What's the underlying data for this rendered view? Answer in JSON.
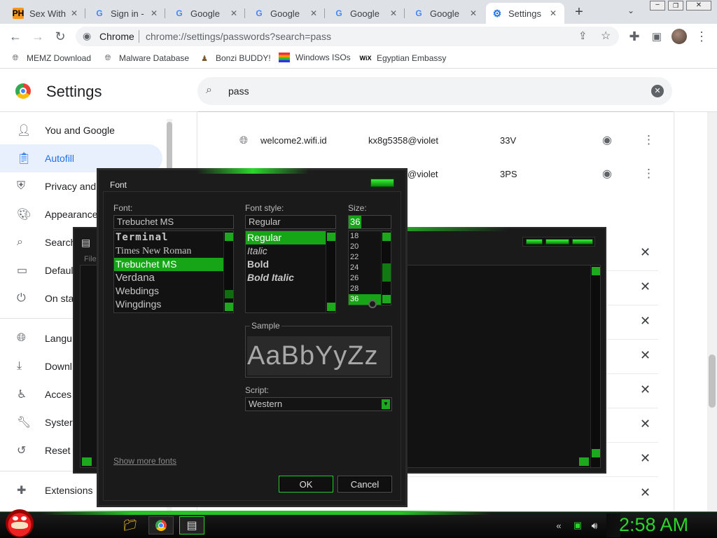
{
  "browser": {
    "tabs": [
      {
        "title": "Sex With",
        "favicon": "PH"
      },
      {
        "title": "Sign in -",
        "favicon": "G"
      },
      {
        "title": "Google",
        "favicon": "G"
      },
      {
        "title": "Google",
        "favicon": "G"
      },
      {
        "title": "Google",
        "favicon": "G"
      },
      {
        "title": "Google",
        "favicon": "G"
      },
      {
        "title": "Settings",
        "favicon": "gear-icon"
      }
    ],
    "omnibox": {
      "site": "Chrome",
      "url": "chrome://settings/passwords?search=pass"
    },
    "bookmarks": [
      {
        "label": "MEMZ Download"
      },
      {
        "label": "Malware Database"
      },
      {
        "label": "Bonzi BUDDY!"
      },
      {
        "label": "Windows ISOs"
      },
      {
        "label": "Egyptian Embassy"
      }
    ]
  },
  "settings": {
    "title": "Settings",
    "search_value": "pass",
    "sidebar": [
      {
        "label": "You and Google",
        "icon": "person-icon"
      },
      {
        "label": "Autofill",
        "icon": "clipboard-icon"
      },
      {
        "label": "Privacy and",
        "icon": "shield-icon"
      },
      {
        "label": "Appearance",
        "icon": "palette-icon"
      },
      {
        "label": "Search",
        "icon": "search-icon"
      },
      {
        "label": "Defaul",
        "icon": "browser-icon"
      },
      {
        "label": "On sta",
        "icon": "power-icon"
      },
      {
        "label": "Langu",
        "icon": "globe-icon"
      },
      {
        "label": "Downl",
        "icon": "download-icon"
      },
      {
        "label": "Acces",
        "icon": "accessibility-icon"
      },
      {
        "label": "Syster",
        "icon": "wrench-icon"
      },
      {
        "label": "Reset",
        "icon": "history-icon"
      },
      {
        "label": "Extensions",
        "icon": "puzzle-icon"
      }
    ],
    "passwords": [
      {
        "site": "welcome2.wifi.id",
        "user": "kx8g5358@violet",
        "password": "33V"
      },
      {
        "site": "",
        "user": "@violet",
        "password": "3PS"
      }
    ]
  },
  "font_dialog": {
    "title": "Font",
    "font_label": "Font:",
    "font_value": "Trebuchet MS",
    "fonts": [
      "Terminal",
      "Times New Roman",
      "Trebuchet MS",
      "Verdana",
      "Webdings",
      "Wingdings"
    ],
    "selected_font": "Trebuchet MS",
    "style_label": "Font style:",
    "style_value": "Regular",
    "styles": [
      "Regular",
      "Italic",
      "Bold",
      "Bold Italic"
    ],
    "selected_style": "Regular",
    "size_label": "Size:",
    "size_value": "36",
    "sizes": [
      "18",
      "20",
      "22",
      "24",
      "26",
      "28",
      "36"
    ],
    "selected_size": "36",
    "sample_label": "Sample",
    "sample_text": "AaBbYyZz",
    "script_label": "Script:",
    "script_value": "Western",
    "show_more": "Show more fonts",
    "ok": "OK",
    "cancel": "Cancel"
  },
  "notepad": {
    "menu_text": "File"
  },
  "taskbar": {
    "clock": "2:58 AM"
  },
  "colors": {
    "accent_green": "#16a516",
    "chrome_blue": "#1a73e8",
    "dialog_bg": "#1a1a1a"
  }
}
